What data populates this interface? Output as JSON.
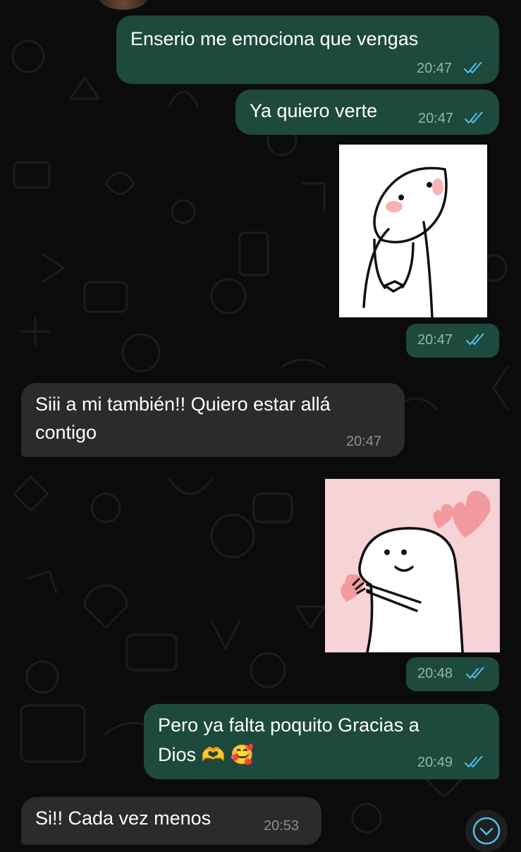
{
  "messages": [
    {
      "type": "outgoing",
      "text": "Enserio me emociona que vengas",
      "time": "20:47",
      "status": "read"
    },
    {
      "type": "outgoing",
      "text": "Ya quiero verte",
      "time": "20:47",
      "status": "read"
    },
    {
      "type": "outgoing-sticker",
      "sticker": "shy-flork-sticker",
      "time": "20:47",
      "status": "read"
    },
    {
      "type": "incoming",
      "line1": "Siii a mi también!! Quiero estar allá",
      "line2": "contigo",
      "time": "20:47"
    },
    {
      "type": "outgoing-sticker",
      "sticker": "flork-holding-heart-sticker",
      "time": "20:48",
      "status": "read"
    },
    {
      "type": "outgoing",
      "line1": "Pero ya falta poquito Gracias a",
      "line2": "Dios 🫶 🥰",
      "time": "20:49",
      "status": "read"
    },
    {
      "type": "incoming",
      "text": "Si!!  Cada vez menos",
      "time": "20:53"
    }
  ],
  "colors": {
    "background": "#0b0b0b",
    "outgoing_bubble": "#1d4a3c",
    "incoming_bubble": "#2b2b2d",
    "read_ticks": "#53bdeb"
  },
  "icons": {
    "read_receipt": "double-check-icon",
    "scroll_down": "chevron-down-icon"
  }
}
